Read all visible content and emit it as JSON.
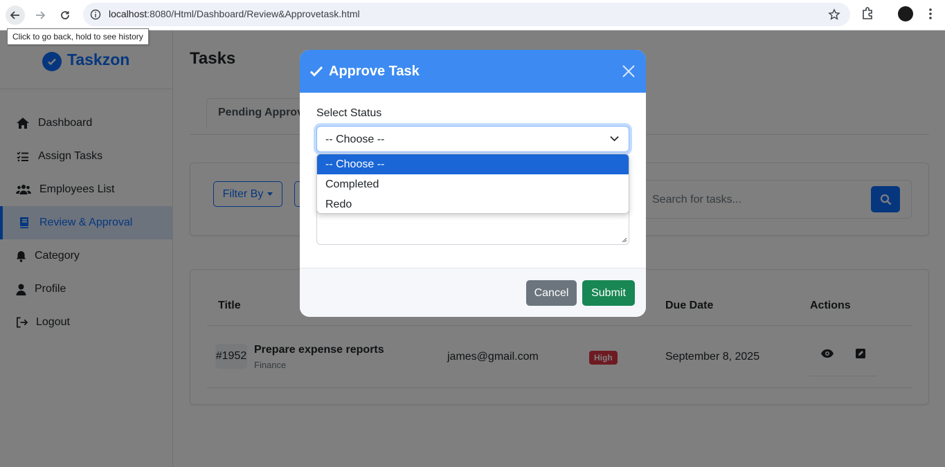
{
  "browser": {
    "url_host": "localhost",
    "url_path": ":8080/Html/Dashboard/Review&Approvetask.html",
    "tooltip": "Click to go back, hold to see history"
  },
  "sidebar": {
    "brand": "Taskzon",
    "items": [
      {
        "label": "Dashboard",
        "icon": "home-icon"
      },
      {
        "label": "Assign Tasks",
        "icon": "list-check-icon"
      },
      {
        "label": "Employees List",
        "icon": "users-icon"
      },
      {
        "label": "Review & Approval",
        "icon": "book-icon",
        "active": true
      },
      {
        "label": "Category",
        "icon": "bell-icon"
      },
      {
        "label": "Profile",
        "icon": "user-icon"
      },
      {
        "label": "Logout",
        "icon": "logout-icon"
      }
    ]
  },
  "main": {
    "title": "Tasks",
    "tab": "Pending Approval",
    "filter_label": "Filter By",
    "search_placeholder": "Search for tasks...",
    "table": {
      "headers": {
        "title": "Title",
        "due": "Due Date",
        "actions": "Actions"
      },
      "row": {
        "id": "#1952",
        "title": "Prepare expense reports",
        "category": "Finance",
        "email": "james@gmail.com",
        "priority": "High",
        "due": "September 8, 2025"
      }
    }
  },
  "modal": {
    "title": "Approve Task",
    "status_label": "Select Status",
    "selected": "-- Choose --",
    "options": [
      "-- Choose --",
      "Completed",
      "Redo"
    ],
    "cancel": "Cancel",
    "submit": "Submit"
  },
  "colors": {
    "primary": "#0d6efd",
    "modal_header": "#3d8bf2",
    "success": "#198754",
    "secondary": "#6c757d",
    "danger": "#dc3545"
  }
}
